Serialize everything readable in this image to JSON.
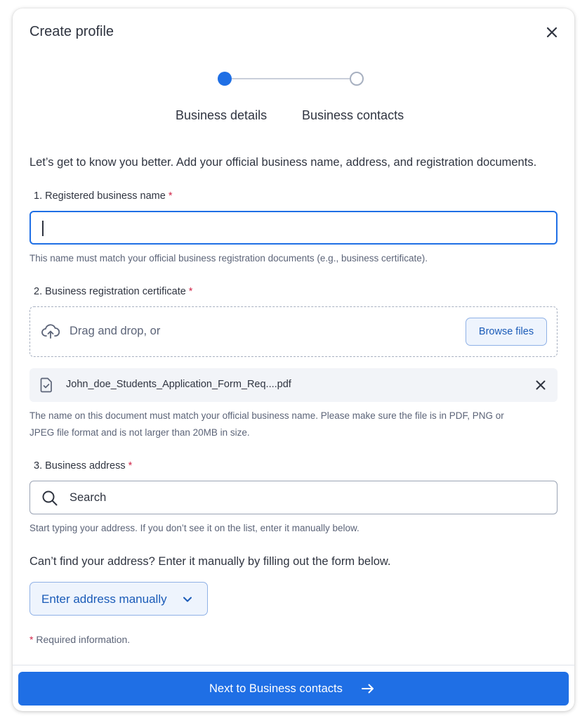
{
  "modal": {
    "title": "Create profile",
    "close_icon": "close-icon"
  },
  "stepper": {
    "steps": [
      {
        "label": "Business details",
        "state": "active"
      },
      {
        "label": "Business contacts",
        "state": "inactive"
      }
    ]
  },
  "intro": "Let’s get to know you better. Add your official business name, address, and registration documents.",
  "business_name": {
    "label": "1. Registered business name",
    "required_marker": "*",
    "value": "",
    "help": "This name must match your official business registration documents (e.g., business certificate)."
  },
  "certificate": {
    "label": "2. Business registration certificate",
    "required_marker": "*",
    "dropzone_text": "Drag and drop, or",
    "browse_label": "Browse files",
    "upload_icon": "cloud-upload-icon",
    "file_icon": "file-check-icon",
    "uploaded_file": "John_doe_Students_Application_Form_Req....pdf",
    "help_line1": "The name on this document must match your official business name. Please make sure the file is in PDF, PNG or",
    "help_line2": "JPEG file format and is not larger than 20MB in size."
  },
  "address": {
    "label": "3. Business address",
    "required_marker": "*",
    "search_placeholder": "Search",
    "search_icon": "search-icon",
    "help": "Start typing your address. If you don’t see it on the list, enter it manually below.",
    "manual_prompt": "Can’t find your address? Enter it manually by filling out the form below.",
    "manual_button": "Enter address manually"
  },
  "required_note": {
    "marker": "*",
    "text": "Required information."
  },
  "footer": {
    "next_label": "Next to Business contacts"
  },
  "colors": {
    "primary": "#1f6fe5",
    "required": "#d1274a",
    "secondary_button_bg": "#eef4fd",
    "secondary_button_border": "#8fb1e6"
  }
}
